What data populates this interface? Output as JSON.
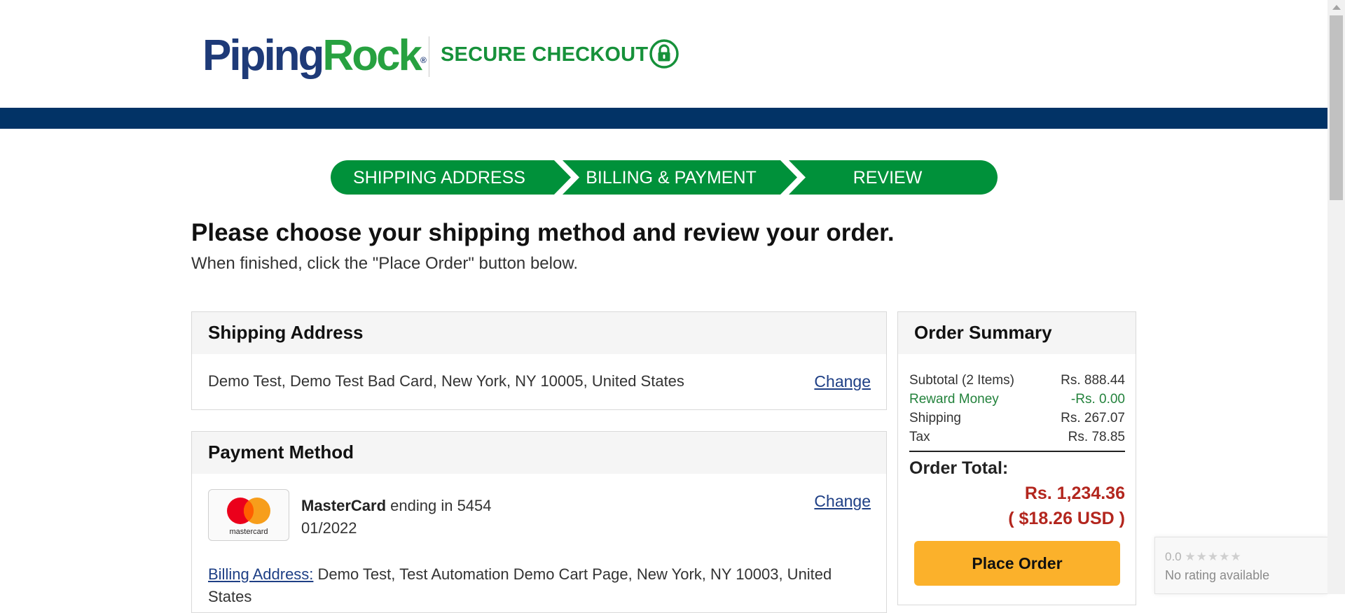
{
  "header": {
    "logo_part1": "Piping",
    "logo_part2": "Rock",
    "logo_mark": "®",
    "secure_checkout": "SECURE CHECKOUT",
    "lock_icon": "lock-icon"
  },
  "steps": [
    {
      "label": "SHIPPING ADDRESS"
    },
    {
      "label": "BILLING & PAYMENT"
    },
    {
      "label": "REVIEW"
    }
  ],
  "page": {
    "title": "Please choose your shipping method and review your order.",
    "subtitle": "When finished, click the \"Place Order\" button below."
  },
  "shipping": {
    "heading": "Shipping Address",
    "address": "Demo Test, Demo Test Bad Card, New York, NY 10005, United States",
    "change_label": "Change"
  },
  "payment": {
    "heading": "Payment Method",
    "card_brand": "MasterCard",
    "card_suffix_text": " ending in 5454",
    "expiry": "01/2022",
    "card_logo_text": "mastercard",
    "change_label": "Change",
    "billing_label": "Billing Address:",
    "billing_address": " Demo Test, Test Automation Demo Cart Page, New York, NY 10003, United States"
  },
  "summary": {
    "heading": "Order Summary",
    "rows": [
      {
        "label": "Subtotal (2 Items)",
        "value": "Rs. 888.44"
      },
      {
        "label": "Reward Money",
        "value": "-Rs. 0.00"
      },
      {
        "label": "Shipping",
        "value": "Rs. 267.07"
      },
      {
        "label": "Tax",
        "value": "Rs. 78.85"
      }
    ],
    "total_label": "Order Total:",
    "total_value": "Rs. 1,234.36",
    "total_usd": "( $18.26 USD )",
    "place_order_label": "Place Order"
  },
  "rating_widget": {
    "score": "0.0",
    "stars": "★★★★★",
    "text": "No rating available"
  },
  "colors": {
    "brand_blue": "#1e3a78",
    "brand_green": "#27a140",
    "step_green": "#00913a",
    "nav_bar": "#023366",
    "total_red": "#b3261e",
    "button_yellow": "#fbb12b"
  }
}
